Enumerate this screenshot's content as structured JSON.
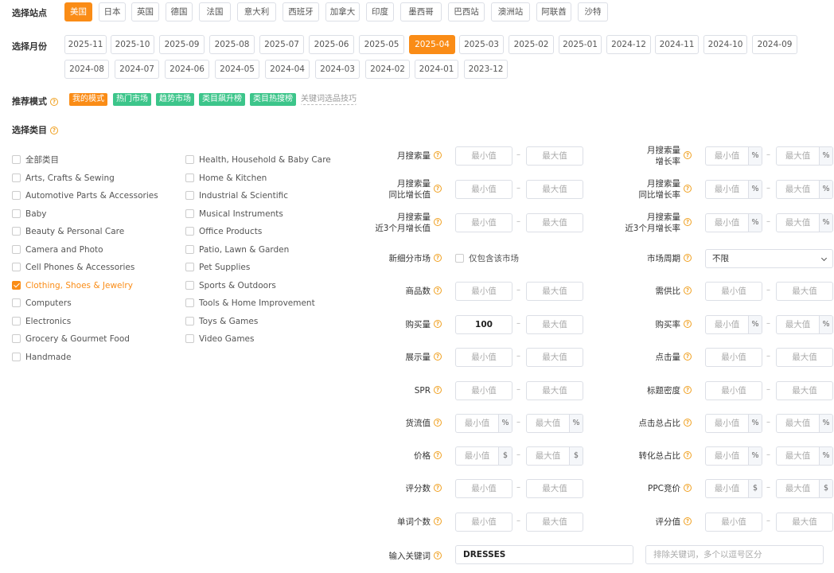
{
  "station": {
    "label": "选择站点",
    "items": [
      "美国",
      "日本",
      "英国",
      "德国",
      "法国",
      "意大利",
      "西班牙",
      "加拿大",
      "印度",
      "墨西哥",
      "巴西站",
      "澳洲站",
      "阿联酋",
      "沙特"
    ],
    "active": "美国"
  },
  "month": {
    "label": "选择月份",
    "row1": [
      "2025-11",
      "2025-10",
      "2025-09",
      "2025-08",
      "2025-07",
      "2025-06",
      "2025-05",
      "2025-04",
      "2025-03",
      "2025-02",
      "2025-01",
      "2024-12",
      "2024-11",
      "2024-10",
      "2024-09"
    ],
    "row2": [
      "2024-08",
      "2024-07",
      "2024-06",
      "2024-05",
      "2024-04",
      "2024-03",
      "2024-02",
      "2024-01",
      "2023-12"
    ],
    "active": "2025-04"
  },
  "mode": {
    "label": "推荐模式",
    "tags": [
      "我的模式",
      "热门市场",
      "趋势市场",
      "类目飙升榜",
      "类目热搜榜"
    ],
    "tip_link": "关键词选品技巧"
  },
  "category": {
    "label": "选择类目",
    "col1": [
      "全部类目",
      "Arts, Crafts & Sewing",
      "Automotive Parts & Accessories",
      "Baby",
      "Beauty & Personal Care",
      "Camera and Photo",
      "Cell Phones & Accessories",
      "Clothing, Shoes & Jewelry",
      "Computers",
      "Electronics",
      "Grocery & Gourmet Food",
      "Handmade"
    ],
    "col2": [
      "Health, Household & Baby Care",
      "Home & Kitchen",
      "Industrial & Scientific",
      "Musical Instruments",
      "Office Products",
      "Patio, Lawn & Garden",
      "Pet Supplies",
      "Sports & Outdoors",
      "Tools & Home Improvement",
      "Toys & Games",
      "Video Games"
    ],
    "checked": "Clothing, Shoes & Jewelry"
  },
  "filters": {
    "min_ph": "最小值",
    "max_ph": "最大值",
    "dash": "–",
    "pct": "%",
    "dollar": "$",
    "monthly_search": "月搜索量",
    "monthly_growth": [
      "月搜索量",
      "增长率"
    ],
    "yoy_value": [
      "月搜索量",
      "同比增长值"
    ],
    "yoy_rate": [
      "月搜索量",
      "同比增长率"
    ],
    "three_month_value": [
      "月搜索量",
      "近3个月增长值"
    ],
    "three_month_rate": [
      "月搜索量",
      "近3个月增长率"
    ],
    "new_segment": "新细分市场",
    "new_segment_option": "仅包含该市场",
    "market_period": "市场周期",
    "market_period_value": "不限",
    "product_count": "商品数",
    "supply_demand": "需供比",
    "purchase_volume": "购买量",
    "purchase_volume_min": "100",
    "purchase_rate": "购买率",
    "impressions": "展示量",
    "clicks": "点击量",
    "spr": "SPR",
    "title_density": "标题密度",
    "gmv": "货流值",
    "click_share": "点击总占比",
    "price": "价格",
    "conversion_share": "转化总占比",
    "review_count": "评分数",
    "ppc_bid": "PPC竞价",
    "word_count": "单词个数",
    "rating": "评分值",
    "keyword_label": "输入关键词",
    "keyword_value": "DRESSES",
    "exclude_ph": "排除关键词，多个以逗号区分"
  }
}
